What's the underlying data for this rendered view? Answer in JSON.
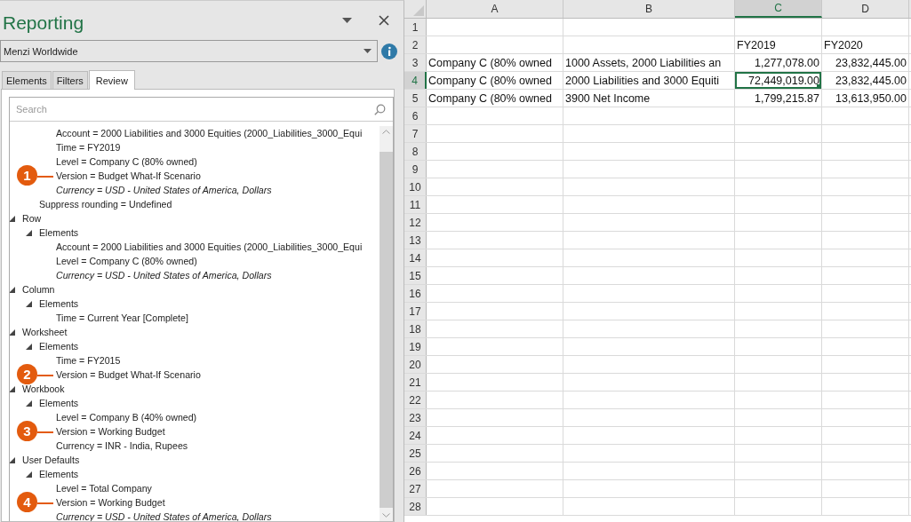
{
  "pane": {
    "title": "Reporting",
    "source": "Menzi Worldwide",
    "tabs": [
      {
        "label": "Elements",
        "selected": false
      },
      {
        "label": "Filters",
        "selected": false
      },
      {
        "label": "Review",
        "selected": true
      }
    ],
    "search": {
      "placeholder": "Search"
    },
    "tree": [
      {
        "children": [
          {
            "children": [
              {
                "label": "Account = 2000 Liabilities and 3000 Equities (2000_Liabilities_3000_Equi"
              },
              {
                "label": "Time = FY2019"
              },
              {
                "label": "Level = Company C (80% owned)"
              },
              {
                "label": "Version = Budget What-If Scenario",
                "callout": "1"
              },
              {
                "label": "Currency = USD - United States of America, Dollars",
                "italic": true
              }
            ]
          },
          {
            "label": "Suppress rounding = Undefined"
          }
        ]
      },
      {
        "label": "Row",
        "expanded": true,
        "children": [
          {
            "label": "Elements",
            "expanded": true,
            "children": [
              {
                "label": "Account = 2000 Liabilities and 3000 Equities (2000_Liabilities_3000_Equi"
              },
              {
                "label": "Level = Company C (80% owned)"
              },
              {
                "label": "Currency = USD - United States of America, Dollars",
                "italic": true
              }
            ]
          }
        ]
      },
      {
        "label": "Column",
        "expanded": true,
        "children": [
          {
            "label": "Elements",
            "expanded": true,
            "children": [
              {
                "label": "Time = Current Year [Complete]"
              }
            ]
          }
        ]
      },
      {
        "label": "Worksheet",
        "expanded": true,
        "children": [
          {
            "label": "Elements",
            "expanded": true,
            "children": [
              {
                "label": "Time = FY2015"
              },
              {
                "label": "Version = Budget What-If Scenario",
                "callout": "2"
              }
            ]
          }
        ]
      },
      {
        "label": "Workbook",
        "expanded": true,
        "children": [
          {
            "label": "Elements",
            "expanded": true,
            "children": [
              {
                "label": "Level = Company B (40% owned)"
              },
              {
                "label": "Version = Working Budget",
                "callout": "3"
              },
              {
                "label": "Currency = INR - India, Rupees"
              }
            ]
          }
        ]
      },
      {
        "label": "User Defaults",
        "expanded": true,
        "children": [
          {
            "label": "Elements",
            "expanded": true,
            "children": [
              {
                "label": "Level = Total Company"
              },
              {
                "label": "Version = Working Budget",
                "callout": "4"
              },
              {
                "label": "Currency = USD - United States of America, Dollars",
                "italic": true
              }
            ]
          }
        ]
      }
    ]
  },
  "sheet": {
    "columns": [
      {
        "label": "A",
        "selected": false
      },
      {
        "label": "B",
        "selected": false
      },
      {
        "label": "C",
        "selected": true
      },
      {
        "label": "D",
        "selected": false
      }
    ],
    "rows": [
      {
        "number": "1",
        "selected": false
      },
      {
        "number": "2",
        "selected": false,
        "cells": [
          {
            "selected": false
          },
          {
            "selected": false
          },
          {
            "text": "FY2019",
            "kind": "text",
            "selected": false
          },
          {
            "text": "FY2020",
            "kind": "text",
            "selected": false
          }
        ]
      },
      {
        "number": "3",
        "selected": false,
        "cells": [
          {
            "text": "Company C (80% owned",
            "kind": "text",
            "selected": false
          },
          {
            "text": "1000 Assets, 2000 Liabilities an",
            "kind": "text",
            "selected": false
          },
          {
            "text": "1,277,078.00",
            "kind": "number",
            "selected": false
          },
          {
            "text": "23,832,445.00",
            "kind": "number",
            "selected": false
          }
        ]
      },
      {
        "number": "4",
        "selected": true,
        "cells": [
          {
            "text": "Company C (80% owned",
            "kind": "text",
            "selected": false
          },
          {
            "text": "2000 Liabilities and 3000 Equiti",
            "kind": "text",
            "selected": false
          },
          {
            "text": "72,449,019.00",
            "kind": "number",
            "selected": true
          },
          {
            "text": "23,832,445.00",
            "kind": "number",
            "selected": false
          }
        ]
      },
      {
        "number": "5",
        "selected": false,
        "cells": [
          {
            "text": "Company C (80% owned",
            "kind": "text",
            "selected": false
          },
          {
            "text": "3900 Net Income",
            "kind": "text",
            "selected": false
          },
          {
            "text": "1,799,215.87",
            "kind": "number",
            "selected": false
          },
          {
            "text": "13,613,950.00",
            "kind": "number",
            "selected": false
          }
        ]
      },
      {
        "number": "6",
        "selected": false
      },
      {
        "number": "7",
        "selected": false
      },
      {
        "number": "8",
        "selected": false
      },
      {
        "number": "9",
        "selected": false
      },
      {
        "number": "10",
        "selected": false
      },
      {
        "number": "11",
        "selected": false
      },
      {
        "number": "12",
        "selected": false
      },
      {
        "number": "13",
        "selected": false
      },
      {
        "number": "14",
        "selected": false
      },
      {
        "number": "15",
        "selected": false
      },
      {
        "number": "16",
        "selected": false
      },
      {
        "number": "17",
        "selected": false
      },
      {
        "number": "18",
        "selected": false
      },
      {
        "number": "19",
        "selected": false
      },
      {
        "number": "20",
        "selected": false
      },
      {
        "number": "21",
        "selected": false
      },
      {
        "number": "22",
        "selected": false
      },
      {
        "number": "23",
        "selected": false
      },
      {
        "number": "24",
        "selected": false
      },
      {
        "number": "25",
        "selected": false
      },
      {
        "number": "26",
        "selected": false
      },
      {
        "number": "27",
        "selected": false
      },
      {
        "number": "28",
        "selected": false
      }
    ]
  }
}
